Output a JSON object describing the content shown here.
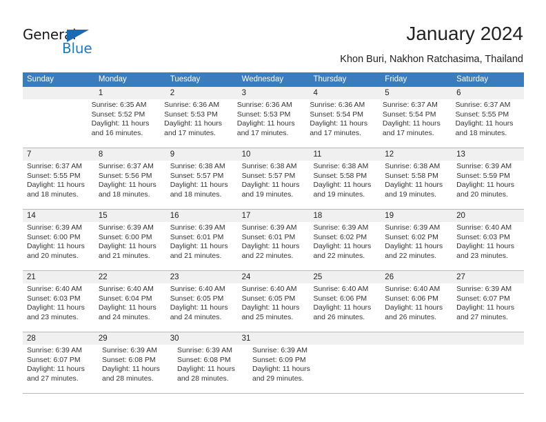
{
  "brand": {
    "name_part1": "General",
    "name_part2": "Blue",
    "triangle_color": "#1a6bb5",
    "blue_color": "#1a7cc4"
  },
  "header": {
    "title": "January 2024",
    "subtitle": "Khon Buri, Nakhon Ratchasima, Thailand"
  },
  "theme": {
    "header_bg": "#3b7cbd",
    "daynum_bg": "#f0f0f0",
    "rule_color": "#b9b9b9"
  },
  "weekdays": [
    "Sunday",
    "Monday",
    "Tuesday",
    "Wednesday",
    "Thursday",
    "Friday",
    "Saturday"
  ],
  "weeks": [
    {
      "days": [
        {
          "date": "",
          "empty": true,
          "sunrise": "",
          "sunset": "",
          "daylight_line1": "",
          "daylight_line2": ""
        },
        {
          "date": "1",
          "empty": false,
          "sunrise": "Sunrise: 6:35 AM",
          "sunset": "Sunset: 5:52 PM",
          "daylight_line1": "Daylight: 11 hours",
          "daylight_line2": "and 16 minutes."
        },
        {
          "date": "2",
          "empty": false,
          "sunrise": "Sunrise: 6:36 AM",
          "sunset": "Sunset: 5:53 PM",
          "daylight_line1": "Daylight: 11 hours",
          "daylight_line2": "and 17 minutes."
        },
        {
          "date": "3",
          "empty": false,
          "sunrise": "Sunrise: 6:36 AM",
          "sunset": "Sunset: 5:53 PM",
          "daylight_line1": "Daylight: 11 hours",
          "daylight_line2": "and 17 minutes."
        },
        {
          "date": "4",
          "empty": false,
          "sunrise": "Sunrise: 6:36 AM",
          "sunset": "Sunset: 5:54 PM",
          "daylight_line1": "Daylight: 11 hours",
          "daylight_line2": "and 17 minutes."
        },
        {
          "date": "5",
          "empty": false,
          "sunrise": "Sunrise: 6:37 AM",
          "sunset": "Sunset: 5:54 PM",
          "daylight_line1": "Daylight: 11 hours",
          "daylight_line2": "and 17 minutes."
        },
        {
          "date": "6",
          "empty": false,
          "sunrise": "Sunrise: 6:37 AM",
          "sunset": "Sunset: 5:55 PM",
          "daylight_line1": "Daylight: 11 hours",
          "daylight_line2": "and 18 minutes."
        }
      ]
    },
    {
      "days": [
        {
          "date": "7",
          "empty": false,
          "sunrise": "Sunrise: 6:37 AM",
          "sunset": "Sunset: 5:55 PM",
          "daylight_line1": "Daylight: 11 hours",
          "daylight_line2": "and 18 minutes."
        },
        {
          "date": "8",
          "empty": false,
          "sunrise": "Sunrise: 6:37 AM",
          "sunset": "Sunset: 5:56 PM",
          "daylight_line1": "Daylight: 11 hours",
          "daylight_line2": "and 18 minutes."
        },
        {
          "date": "9",
          "empty": false,
          "sunrise": "Sunrise: 6:38 AM",
          "sunset": "Sunset: 5:57 PM",
          "daylight_line1": "Daylight: 11 hours",
          "daylight_line2": "and 18 minutes."
        },
        {
          "date": "10",
          "empty": false,
          "sunrise": "Sunrise: 6:38 AM",
          "sunset": "Sunset: 5:57 PM",
          "daylight_line1": "Daylight: 11 hours",
          "daylight_line2": "and 19 minutes."
        },
        {
          "date": "11",
          "empty": false,
          "sunrise": "Sunrise: 6:38 AM",
          "sunset": "Sunset: 5:58 PM",
          "daylight_line1": "Daylight: 11 hours",
          "daylight_line2": "and 19 minutes."
        },
        {
          "date": "12",
          "empty": false,
          "sunrise": "Sunrise: 6:38 AM",
          "sunset": "Sunset: 5:58 PM",
          "daylight_line1": "Daylight: 11 hours",
          "daylight_line2": "and 19 minutes."
        },
        {
          "date": "13",
          "empty": false,
          "sunrise": "Sunrise: 6:39 AM",
          "sunset": "Sunset: 5:59 PM",
          "daylight_line1": "Daylight: 11 hours",
          "daylight_line2": "and 20 minutes."
        }
      ]
    },
    {
      "days": [
        {
          "date": "14",
          "empty": false,
          "sunrise": "Sunrise: 6:39 AM",
          "sunset": "Sunset: 6:00 PM",
          "daylight_line1": "Daylight: 11 hours",
          "daylight_line2": "and 20 minutes."
        },
        {
          "date": "15",
          "empty": false,
          "sunrise": "Sunrise: 6:39 AM",
          "sunset": "Sunset: 6:00 PM",
          "daylight_line1": "Daylight: 11 hours",
          "daylight_line2": "and 21 minutes."
        },
        {
          "date": "16",
          "empty": false,
          "sunrise": "Sunrise: 6:39 AM",
          "sunset": "Sunset: 6:01 PM",
          "daylight_line1": "Daylight: 11 hours",
          "daylight_line2": "and 21 minutes."
        },
        {
          "date": "17",
          "empty": false,
          "sunrise": "Sunrise: 6:39 AM",
          "sunset": "Sunset: 6:01 PM",
          "daylight_line1": "Daylight: 11 hours",
          "daylight_line2": "and 22 minutes."
        },
        {
          "date": "18",
          "empty": false,
          "sunrise": "Sunrise: 6:39 AM",
          "sunset": "Sunset: 6:02 PM",
          "daylight_line1": "Daylight: 11 hours",
          "daylight_line2": "and 22 minutes."
        },
        {
          "date": "19",
          "empty": false,
          "sunrise": "Sunrise: 6:39 AM",
          "sunset": "Sunset: 6:02 PM",
          "daylight_line1": "Daylight: 11 hours",
          "daylight_line2": "and 22 minutes."
        },
        {
          "date": "20",
          "empty": false,
          "sunrise": "Sunrise: 6:40 AM",
          "sunset": "Sunset: 6:03 PM",
          "daylight_line1": "Daylight: 11 hours",
          "daylight_line2": "and 23 minutes."
        }
      ]
    },
    {
      "days": [
        {
          "date": "21",
          "empty": false,
          "sunrise": "Sunrise: 6:40 AM",
          "sunset": "Sunset: 6:03 PM",
          "daylight_line1": "Daylight: 11 hours",
          "daylight_line2": "and 23 minutes."
        },
        {
          "date": "22",
          "empty": false,
          "sunrise": "Sunrise: 6:40 AM",
          "sunset": "Sunset: 6:04 PM",
          "daylight_line1": "Daylight: 11 hours",
          "daylight_line2": "and 24 minutes."
        },
        {
          "date": "23",
          "empty": false,
          "sunrise": "Sunrise: 6:40 AM",
          "sunset": "Sunset: 6:05 PM",
          "daylight_line1": "Daylight: 11 hours",
          "daylight_line2": "and 24 minutes."
        },
        {
          "date": "24",
          "empty": false,
          "sunrise": "Sunrise: 6:40 AM",
          "sunset": "Sunset: 6:05 PM",
          "daylight_line1": "Daylight: 11 hours",
          "daylight_line2": "and 25 minutes."
        },
        {
          "date": "25",
          "empty": false,
          "sunrise": "Sunrise: 6:40 AM",
          "sunset": "Sunset: 6:06 PM",
          "daylight_line1": "Daylight: 11 hours",
          "daylight_line2": "and 26 minutes."
        },
        {
          "date": "26",
          "empty": false,
          "sunrise": "Sunrise: 6:40 AM",
          "sunset": "Sunset: 6:06 PM",
          "daylight_line1": "Daylight: 11 hours",
          "daylight_line2": "and 26 minutes."
        },
        {
          "date": "27",
          "empty": false,
          "sunrise": "Sunrise: 6:39 AM",
          "sunset": "Sunset: 6:07 PM",
          "daylight_line1": "Daylight: 11 hours",
          "daylight_line2": "and 27 minutes."
        }
      ]
    },
    {
      "days": [
        {
          "date": "28",
          "empty": false,
          "sunrise": "Sunrise: 6:39 AM",
          "sunset": "Sunset: 6:07 PM",
          "daylight_line1": "Daylight: 11 hours",
          "daylight_line2": "and 27 minutes."
        },
        {
          "date": "29",
          "empty": false,
          "sunrise": "Sunrise: 6:39 AM",
          "sunset": "Sunset: 6:08 PM",
          "daylight_line1": "Daylight: 11 hours",
          "daylight_line2": "and 28 minutes."
        },
        {
          "date": "30",
          "empty": false,
          "sunrise": "Sunrise: 6:39 AM",
          "sunset": "Sunset: 6:08 PM",
          "daylight_line1": "Daylight: 11 hours",
          "daylight_line2": "and 28 minutes."
        },
        {
          "date": "31",
          "empty": false,
          "sunrise": "Sunrise: 6:39 AM",
          "sunset": "Sunset: 6:09 PM",
          "daylight_line1": "Daylight: 11 hours",
          "daylight_line2": "and 29 minutes."
        },
        {
          "date": "",
          "empty": true,
          "sunrise": "",
          "sunset": "",
          "daylight_line1": "",
          "daylight_line2": ""
        },
        {
          "date": "",
          "empty": true,
          "sunrise": "",
          "sunset": "",
          "daylight_line1": "",
          "daylight_line2": ""
        },
        {
          "date": "",
          "empty": true,
          "sunrise": "",
          "sunset": "",
          "daylight_line1": "",
          "daylight_line2": ""
        }
      ]
    }
  ]
}
